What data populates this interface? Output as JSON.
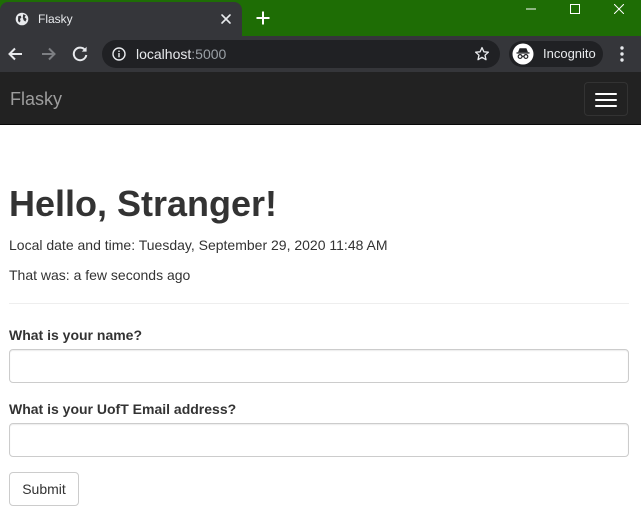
{
  "browser": {
    "tab": {
      "title": "Flasky",
      "favicon": "globe-icon"
    },
    "new_tab_icon": "plus-icon",
    "window_controls": [
      "minimize-icon",
      "maximize-icon",
      "close-icon"
    ],
    "address": {
      "host": "localhost",
      "port": ":5000"
    },
    "profile": {
      "label": "Incognito",
      "icon": "incognito-icon"
    },
    "colors": {
      "frame": "#1e6d05",
      "toolbar": "#35363a",
      "omnibox": "#202124"
    }
  },
  "navbar": {
    "brand": "Flasky",
    "background": "#222222"
  },
  "main": {
    "heading": "Hello, Stranger!",
    "local_time": "Local date and time: Tuesday, September 29, 2020 11:48 AM",
    "ago": "That was: a few seconds ago"
  },
  "form": {
    "name_label": "What is your name?",
    "name_value": "",
    "email_label": "What is your UofT Email address?",
    "email_value": "",
    "submit_label": "Submit"
  }
}
